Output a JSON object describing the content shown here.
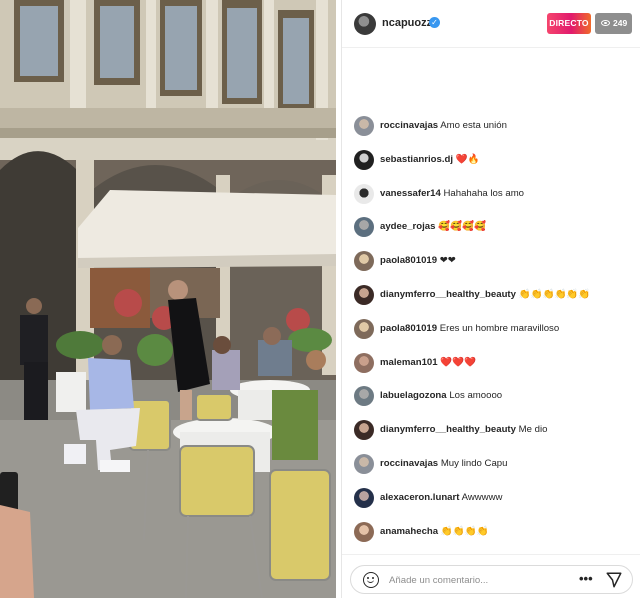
{
  "header": {
    "username": "ncapuozzo",
    "live_label": "DIRECTO",
    "viewer_count": "249",
    "icons": [
      "verified-badge-icon",
      "eye-icon"
    ]
  },
  "comments": [
    {
      "user": "roccinavajas",
      "text": "Amo esta unión"
    },
    {
      "user": "sebastianrios.dj",
      "text": "❤️🔥"
    },
    {
      "user": "vanessafer14",
      "text": "Hahahaha los amo"
    },
    {
      "user": "aydee_rojas",
      "text": "🥰🥰🥰🥰"
    },
    {
      "user": "paola801019",
      "text": "❤❤"
    },
    {
      "user": "dianymferro__healthy_beauty",
      "text": "👏👏👏👏👏👏"
    },
    {
      "user": "paola801019",
      "text": "Eres un hombre maravilloso"
    },
    {
      "user": "maleman101",
      "text": "❤️❤️❤️"
    },
    {
      "user": "labuelagozona",
      "text": "Los amoooo"
    },
    {
      "user": "dianymferro__healthy_beauty",
      "text": "Me dio"
    },
    {
      "user": "roccinavajas",
      "text": "Muy lindo Capu"
    },
    {
      "user": "alexaceron.lunart",
      "text": "Awwwww"
    },
    {
      "user": "anamahecha",
      "text": "👏👏👏👏"
    }
  ],
  "footer": {
    "placeholder": "Añade un comentario...",
    "more_label": "•••",
    "icons": [
      "emoji-icon",
      "send-icon"
    ]
  },
  "colors": {
    "live_gradient_start": "#f5456d",
    "live_gradient_end": "#f06a2a",
    "viewer_badge": "#8e8e8e",
    "verified": "#3897f0"
  }
}
